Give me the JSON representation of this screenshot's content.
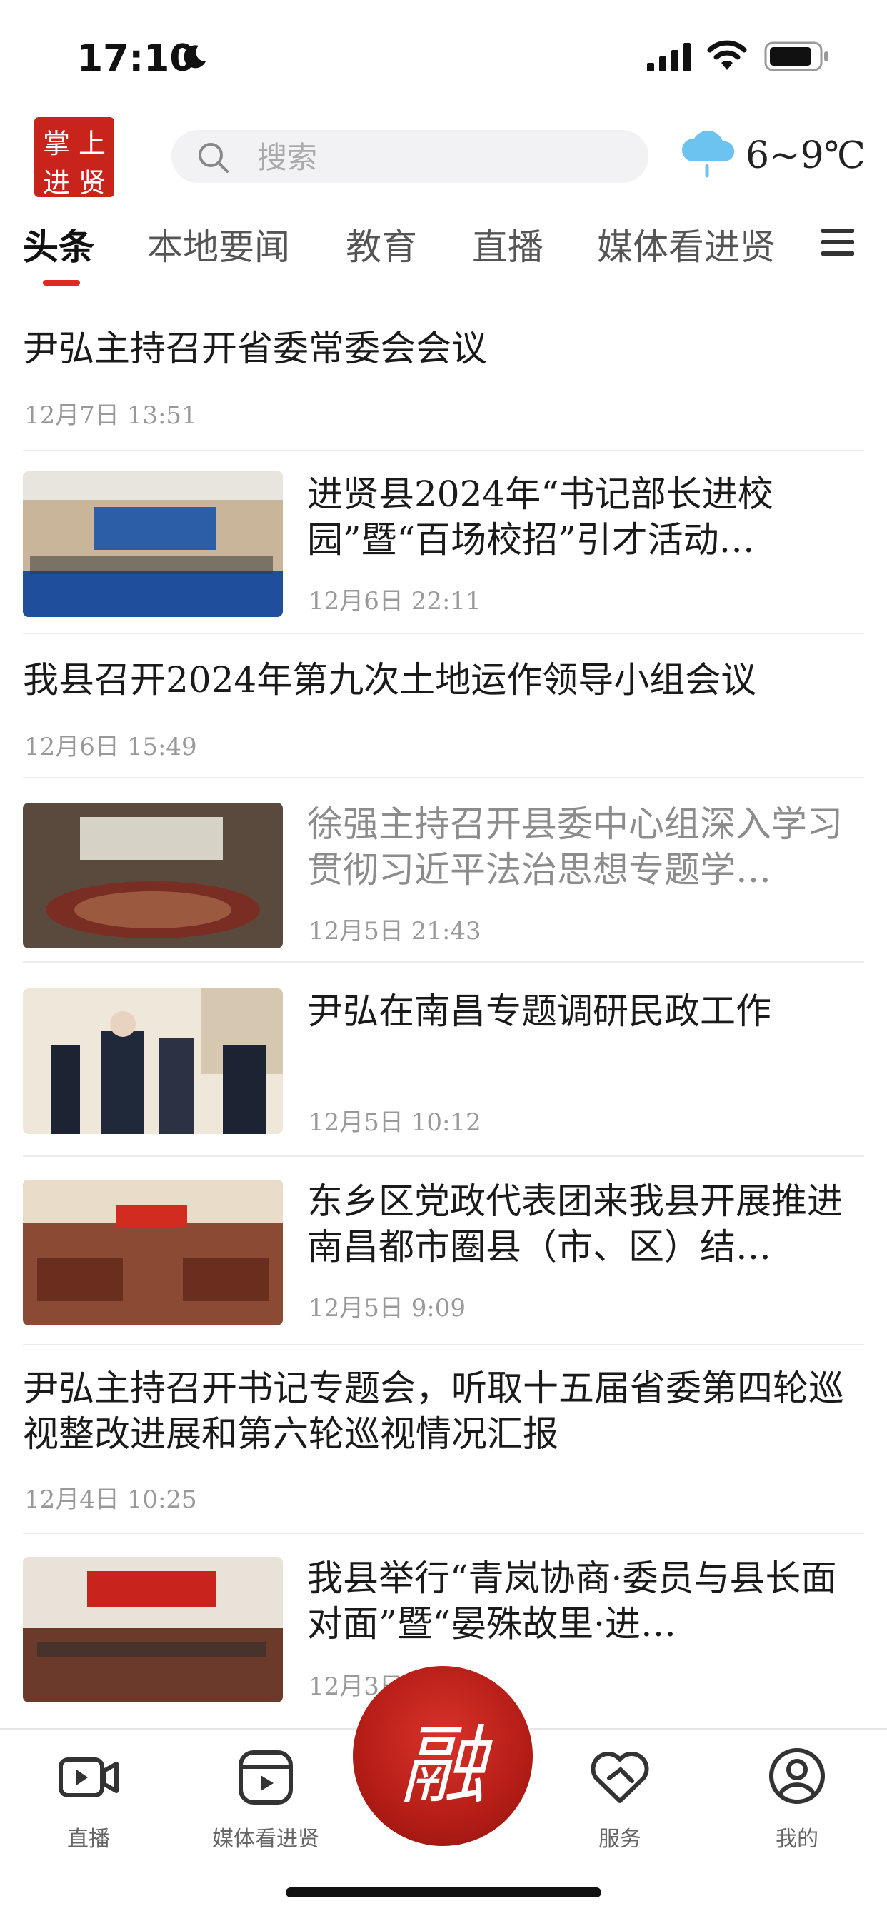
{
  "status_bar": {
    "time": "17:10"
  },
  "header": {
    "logo_chars": [
      "掌",
      "上",
      "进",
      "贤"
    ],
    "search_placeholder": "搜索",
    "weather": {
      "temp": "6~9℃",
      "icon": "cloud-rain-icon"
    }
  },
  "tabs": [
    "头条",
    "本地要闻",
    "教育",
    "直播",
    "媒体看进贤"
  ],
  "active_tab": 0,
  "news": [
    {
      "title": "尹弘主持召开省委常委会会议",
      "date": "12月7日 13:51",
      "has_image": false
    },
    {
      "title": "进贤县2024年“书记部长进校园”暨“百场校招”引才活动…",
      "date": "12月6日 22:11",
      "has_image": true
    },
    {
      "title": "我县召开2024年第九次土地运作领导小组会议",
      "date": "12月6日 15:49",
      "has_image": false
    },
    {
      "title": "徐强主持召开县委中心组深入学习贯彻习近平法治思想专题学…",
      "date": "12月5日 21:43",
      "has_image": true,
      "read": true
    },
    {
      "title": "尹弘在南昌专题调研民政工作",
      "date": "12月5日 10:12",
      "has_image": true
    },
    {
      "title": "东乡区党政代表团来我县开展推进南昌都市圈县（市、区）结…",
      "date": "12月5日 9:09",
      "has_image": true
    },
    {
      "title": "尹弘主持召开书记专题会，听取十五届省委第四轮巡视整改进展和第六轮巡视情况汇报",
      "date": "12月4日 10:25",
      "has_image": false
    },
    {
      "title": "我县举行“青岚协商·委员与县长面对面”暨“晏殊故里·进…",
      "date": "12月3日",
      "has_image": true
    }
  ],
  "bottom_nav": {
    "items": [
      "直播",
      "媒体看进贤",
      "服务",
      "我的"
    ],
    "center_label": "融"
  },
  "colors": {
    "accent": "#e02a1e",
    "logo_bg": "#c8241c"
  }
}
